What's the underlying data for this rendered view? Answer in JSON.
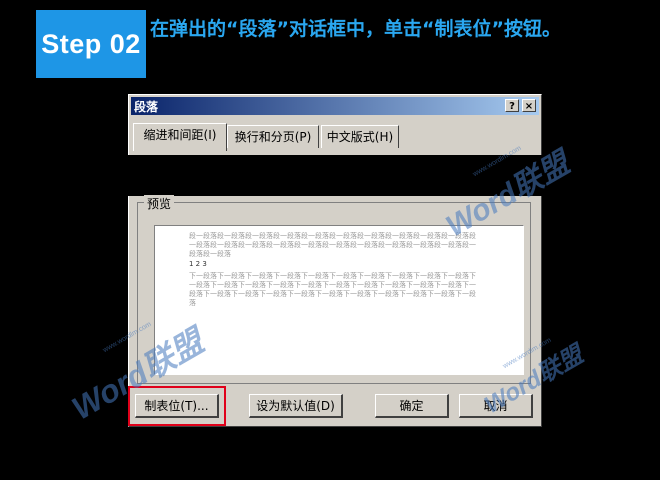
{
  "header": {
    "step_label": "Step 02",
    "instruction": "在弹出的“段落”对话框中，单击“制表位”按钮。"
  },
  "dialog": {
    "title": "段落",
    "help_button": "?",
    "close_button": "×",
    "tabs": [
      "缩进和间距(I)",
      "换行和分页(P)",
      "中文版式(H)"
    ],
    "preview_label": "预览",
    "preview": {
      "prev_paragraph": "段一段落段一段落段一段落段一段落段一段落段一段落段一段落段一段落段一段落段一段落段一段落段一段落段一段落段一段落段一段落段一段落段一段落段一段落段一段落段一段落段一段落段一段落",
      "current_paragraph": "1 2 3",
      "next_paragraph": "下一段落下一段落下一段落下一段落下一段落下一段落下一段落下一段落下一段落下一段落下一段落下一段落下一段落下一段落下一段落下一段落下一段落下一段落下一段落下一段落下一段落下一段落下一段落下一段落下一段落下一段落下一段落下一段落下一段落下一段落下一段落"
    },
    "buttons": {
      "tabs_button": "制表位(T)...",
      "default_button": "设为默认值(D)",
      "ok_button": "确定",
      "cancel_button": "取消"
    }
  },
  "watermark": {
    "brand": "Word联盟",
    "url": "www.wordlm.com"
  },
  "colors": {
    "badge": "#1e96e6",
    "instruction_text": "#2aa7f0",
    "highlight": "#e0001a"
  }
}
